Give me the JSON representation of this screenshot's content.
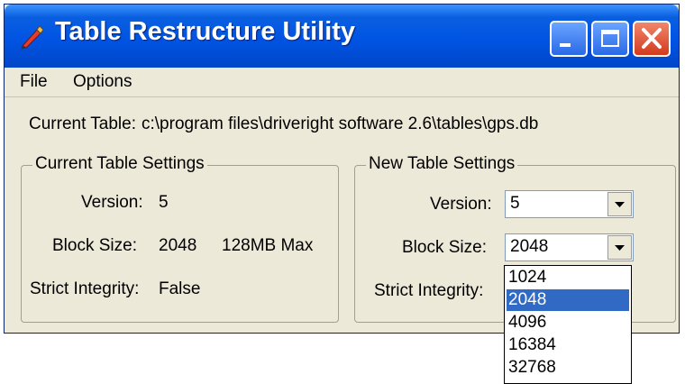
{
  "window": {
    "title": "Table Restructure Utility",
    "accent": "#0054e3"
  },
  "menu": {
    "items": [
      "File",
      "Options"
    ]
  },
  "current_table": {
    "label": "Current Table:",
    "path": "c:\\program files\\driveright software 2.6\\tables\\gps.db"
  },
  "current_settings": {
    "legend": "Current Table Settings",
    "version_label": "Version:",
    "version_value": "5",
    "block_size_label": "Block Size:",
    "block_size_value": "2048",
    "block_size_note": "128MB Max",
    "strict_label": "Strict Integrity:",
    "strict_value": "False"
  },
  "new_settings": {
    "legend": "New Table Settings",
    "version_label": "Version:",
    "version_value": "5",
    "block_size_label": "Block Size:",
    "block_size_value": "2048",
    "strict_label": "Strict Integrity:"
  },
  "block_size_dropdown": {
    "options": [
      "1024",
      "2048",
      "4096",
      "16384",
      "32768"
    ],
    "selected": "2048",
    "highlight_color": "#316ac5"
  },
  "icons": {
    "app": "pen-icon",
    "minimize": "minimize-icon",
    "maximize": "maximize-icon",
    "close": "close-icon",
    "dropdown_arrow": "chevron-down-icon"
  }
}
